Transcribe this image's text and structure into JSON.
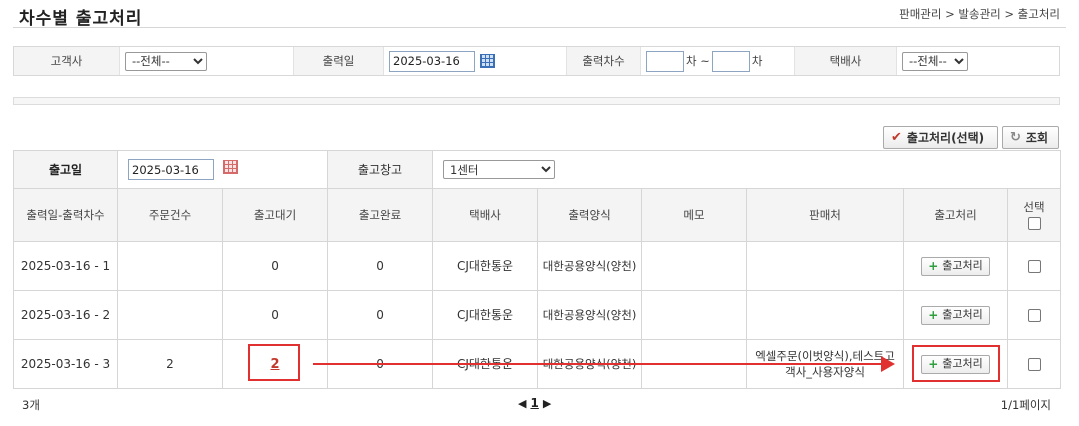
{
  "header": {
    "title": "차수별 출고처리",
    "breadcrumb": "판매관리 > 발송관리 > 출고처리"
  },
  "filter": {
    "customer_label": "고객사",
    "customer_value": "--전체--",
    "print_date_label": "출력일",
    "print_date_value": "2025-03-16",
    "print_round_label": "출력차수",
    "round_from": "",
    "round_sep": "차 ~",
    "round_to": "",
    "round_suffix": "차",
    "courier_label": "택배사",
    "courier_value": "--전체--"
  },
  "actions": {
    "ship_selected_label": "출고처리(선택)",
    "search_label": "조회"
  },
  "top_row": {
    "ship_date_label": "출고일",
    "ship_date_value": "2025-03-16",
    "warehouse_label": "출고창고",
    "warehouse_value": "1센터"
  },
  "columns": [
    "출력일-출력차수",
    "주문건수",
    "출고대기",
    "출고완료",
    "택배사",
    "출력양식",
    "메모",
    "판매처",
    "출고처리",
    "선택"
  ],
  "rows": [
    {
      "round": "2025-03-16 - 1",
      "orders": "",
      "waiting": "0",
      "done": "0",
      "courier": "CJ대한통운",
      "form": "대한공용양식(양천)",
      "memo": "",
      "seller": "",
      "action": "출고처리"
    },
    {
      "round": "2025-03-16 - 2",
      "orders": "",
      "waiting": "0",
      "done": "0",
      "courier": "CJ대한통운",
      "form": "대한공용양식(양천)",
      "memo": "",
      "seller": "",
      "action": "출고처리"
    },
    {
      "round": "2025-03-16 - 3",
      "orders": "2",
      "waiting": "2",
      "done": "0",
      "courier": "CJ대한통운",
      "form": "대한공용양식(양천)",
      "memo": "",
      "seller": "엑셀주문(이벗양식),테스트고객사_사용자양식",
      "action": "출고처리"
    }
  ],
  "footer": {
    "count": "3개",
    "page": "1",
    "page_info": "1/1페이지"
  },
  "colors": {
    "highlight": "#e03030",
    "plus": "#2e9e3e",
    "check": "#c0392b"
  }
}
